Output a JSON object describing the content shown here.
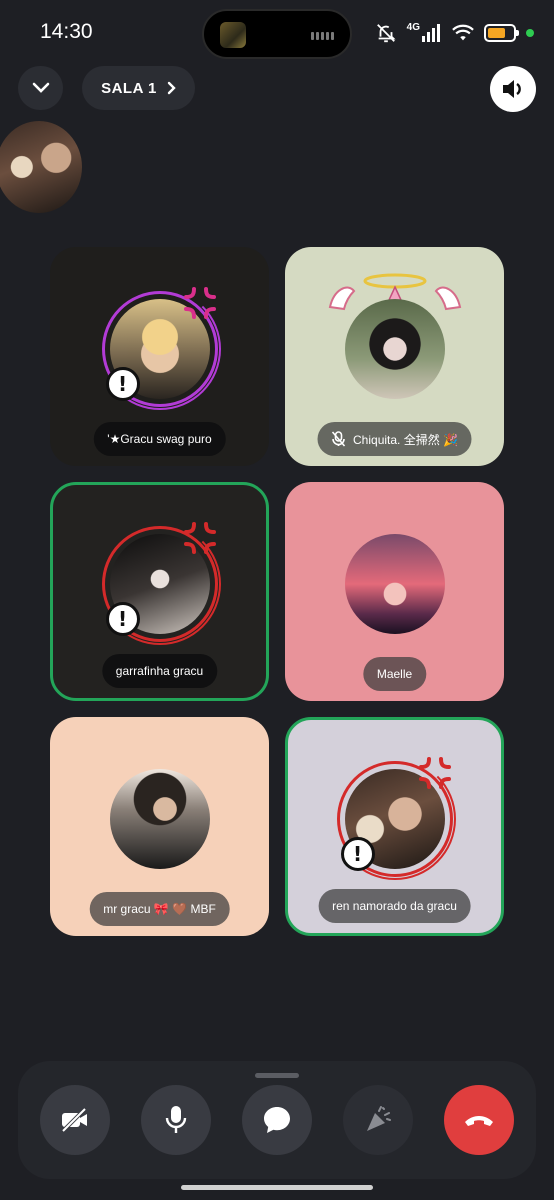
{
  "status": {
    "time": "14:30",
    "network": "4G",
    "battery_color": "#f5a623",
    "indicator_color": "#2ecc51"
  },
  "header": {
    "room_label": "SALA 1"
  },
  "tiles": [
    {
      "name": "'★Gracu swag puro",
      "bg": "#1f1e1c",
      "pill": "dark",
      "speaking": false,
      "ring": "#b23bd6",
      "alert": true,
      "anger": true
    },
    {
      "name": "Chiquita. 全掃然 🎉",
      "bg": "#d5dac2",
      "pill": "gray",
      "speaking": false,
      "muted": true,
      "halo": true
    },
    {
      "name": "garrafinha gracu",
      "bg": "#232220",
      "pill": "dark",
      "speaking": true,
      "ring": "#d42a2a",
      "alert": true,
      "anger": true
    },
    {
      "name": "Maelle",
      "bg": "#e8939a",
      "pill": "gray",
      "speaking": false
    },
    {
      "name": "mr gracu 🎀    🤎 MBF",
      "bg": "#f6d1b9",
      "pill": "gray",
      "speaking": false
    },
    {
      "name": "ren namorado da gracu",
      "bg": "#d4d0da",
      "pill": "gray",
      "speaking": true,
      "ring": "#d42a2a",
      "alert": true,
      "anger": true
    }
  ],
  "controls": {
    "accent_end": "#e03e3e",
    "speaking_border": "#23a559"
  }
}
